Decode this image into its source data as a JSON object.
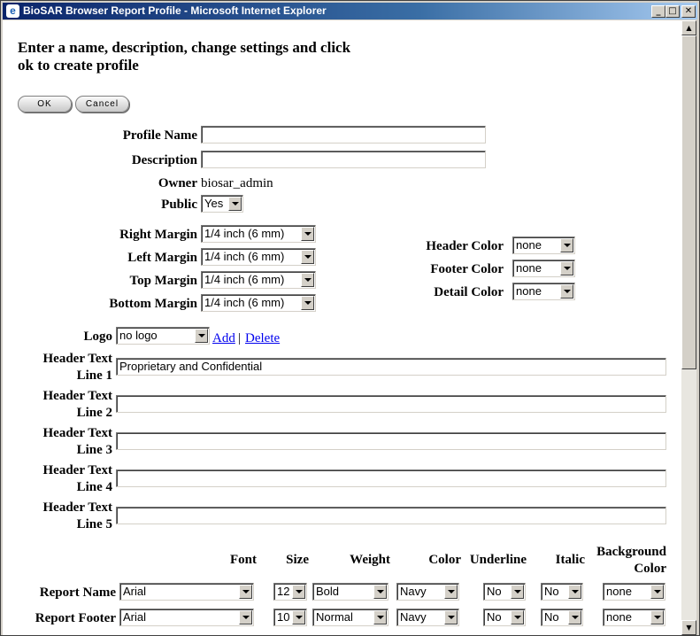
{
  "window": {
    "title": "BioSAR Browser Report Profile - Microsoft Internet Explorer",
    "icon": "ie-icon",
    "min_glyph": "_",
    "max_glyph": "□",
    "close_glyph": "✕"
  },
  "page": {
    "heading": "Enter a name, description, change settings and click ok to create profile"
  },
  "buttons": {
    "ok_label": "OK",
    "cancel_label": "Cancel"
  },
  "profile": {
    "name_label": "Profile Name",
    "name_value": "",
    "description_label": "Description",
    "description_value": "",
    "owner_label": "Owner",
    "owner_value": "biosar_admin",
    "public_label": "Public",
    "public_value": "Yes"
  },
  "margins": {
    "right_label": "Right Margin",
    "right_value": "1/4 inch (6 mm)",
    "left_label": "Left Margin",
    "left_value": "1/4 inch (6 mm)",
    "top_label": "Top Margin",
    "top_value": "1/4 inch (6 mm)",
    "bottom_label": "Bottom Margin",
    "bottom_value": "1/4 inch (6 mm)"
  },
  "colors": {
    "header_label": "Header Color",
    "header_value": "none",
    "footer_label": "Footer Color",
    "footer_value": "none",
    "detail_label": "Detail Color",
    "detail_value": "none"
  },
  "logo": {
    "label": "Logo",
    "value": "no logo",
    "add_link": "Add",
    "separator": "|",
    "delete_link": "Delete"
  },
  "header_text": [
    {
      "label1": "Header Text",
      "label2": "Line 1",
      "value": "Proprietary and Confidential"
    },
    {
      "label1": "Header Text",
      "label2": "Line 2",
      "value": ""
    },
    {
      "label1": "Header Text",
      "label2": "Line 3",
      "value": ""
    },
    {
      "label1": "Header Text",
      "label2": "Line 4",
      "value": ""
    },
    {
      "label1": "Header Text",
      "label2": "Line 5",
      "value": ""
    }
  ],
  "font_table": {
    "headers": {
      "font": "Font",
      "size": "Size",
      "weight": "Weight",
      "color": "Color",
      "underline": "Underline",
      "italic": "Italic",
      "background1": "Background",
      "background2": "Color"
    },
    "rows": [
      {
        "label": "Report Name",
        "font": "Arial",
        "size": "12",
        "weight": "Bold",
        "color": "Navy",
        "underline": "No",
        "italic": "No",
        "background": "none"
      },
      {
        "label": "Report Footer",
        "font": "Arial",
        "size": "10",
        "weight": "Normal",
        "color": "Navy",
        "underline": "No",
        "italic": "No",
        "background": "none"
      }
    ]
  }
}
